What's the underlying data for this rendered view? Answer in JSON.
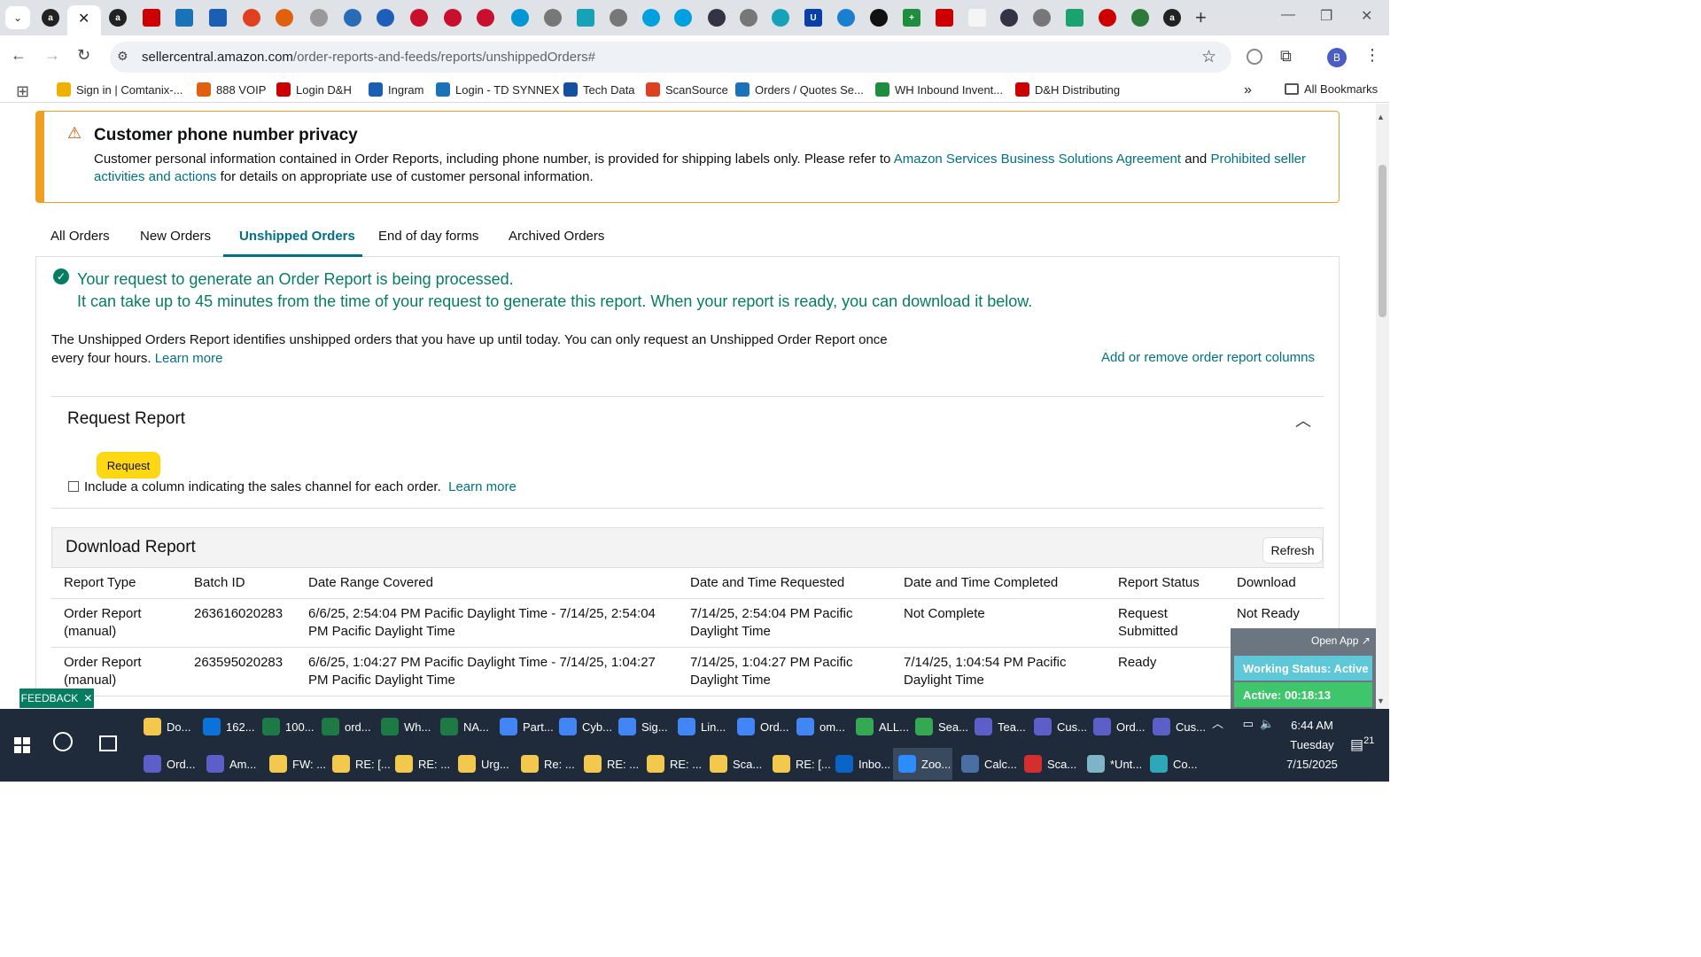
{
  "browser": {
    "url_host": "sellercentral.amazon.com",
    "url_path": "/order-reports-and-feeds/reports/unshippedOrders#",
    "profile_initial": "B",
    "bookmarks": [
      {
        "label": "Sign in | Comtanix-...",
        "color": "#f0b000"
      },
      {
        "label": "888 VOIP",
        "color": "#e06010"
      },
      {
        "label": "Login D&H",
        "color": "#c00"
      },
      {
        "label": "Ingram",
        "color": "#1a5fb4"
      },
      {
        "label": "Login - TD SYNNEX",
        "color": "#1a73b8"
      },
      {
        "label": "Tech Data",
        "color": "#1550a0"
      },
      {
        "label": "ScanSource",
        "color": "#e04020"
      },
      {
        "label": "Orders / Quotes Se...",
        "color": "#1a73b8"
      },
      {
        "label": "WH Inbound Invent...",
        "color": "#1e8e3e"
      },
      {
        "label": "D&H Distributing",
        "color": "#c00"
      }
    ],
    "all_bookmarks_label": "All Bookmarks"
  },
  "alert": {
    "title": "Customer phone number privacy",
    "body_1": "Customer personal information contained in Order Reports, including phone number, is provided for shipping labels only. Please refer to ",
    "link_1": "Amazon Services Business Solutions Agreement",
    "body_2": " and ",
    "link_2": "Prohibited seller activities and actions",
    "body_3": " for details on appropriate use of customer personal information."
  },
  "tabs": [
    "All Orders",
    "New Orders",
    "Unshipped Orders",
    "End of day forms",
    "Archived Orders"
  ],
  "success": {
    "line1": "Your request to generate an Order Report is being processed.",
    "line2": "It can take up to 45 minutes from the time of your request to generate this report. When your report is ready, you can download it below."
  },
  "description": {
    "text": "The Unshipped Orders Report identifies unshipped orders that you have up until today. You can only request an Unshipped Order Report once every four hours. ",
    "learn_more": "Learn more",
    "add_columns": "Add or remove order report columns"
  },
  "request": {
    "title": "Request Report",
    "button": "Request",
    "checkbox_label": "Include a column indicating the sales channel for each order.",
    "learn_more": "Learn more"
  },
  "download": {
    "title": "Download Report",
    "refresh": "Refresh",
    "columns": [
      "Report Type",
      "Batch ID",
      "Date Range Covered",
      "Date and Time Requested",
      "Date and Time Completed",
      "Report Status",
      "Download"
    ],
    "rows": [
      [
        "Order Report (manual)",
        "263616020283",
        "6/6/25, 2:54:04 PM Pacific Daylight Time - 7/14/25, 2:54:04 PM Pacific Daylight Time",
        "7/14/25, 2:54:04 PM Pacific Daylight Time",
        "Not Complete",
        "Request Submitted",
        "Not Ready"
      ],
      [
        "Order Report (manual)",
        "263595020283",
        "6/6/25, 1:04:27 PM Pacific Daylight Time - 7/14/25, 1:04:27 PM Pacific Daylight Time",
        "7/14/25, 1:04:27 PM Pacific Daylight Time",
        "7/14/25, 1:04:54 PM Pacific Daylight Time",
        "Ready",
        ""
      ]
    ]
  },
  "feedback": "FEEDBACK",
  "widget": {
    "open_app": "Open App ↗",
    "status": "Working Status: Active",
    "active": "Active: 00:18:13"
  },
  "taskbar": {
    "row1": [
      {
        "label": "Do...",
        "color": "#f2c94c"
      },
      {
        "label": "162...",
        "color": "#0b72d9"
      },
      {
        "label": "100...",
        "color": "#1d7a45"
      },
      {
        "label": "ord...",
        "color": "#1d7a45"
      },
      {
        "label": "Wh...",
        "color": "#1d7a45"
      },
      {
        "label": "NA...",
        "color": "#1d7a45"
      },
      {
        "label": "Part...",
        "color": "#4285f4"
      },
      {
        "label": "Cyb...",
        "color": "#4285f4"
      },
      {
        "label": "Sig...",
        "color": "#4285f4"
      },
      {
        "label": "Lin...",
        "color": "#4285f4"
      },
      {
        "label": "Ord...",
        "color": "#4285f4"
      },
      {
        "label": "om...",
        "color": "#4285f4"
      },
      {
        "label": "ALL...",
        "color": "#34a853"
      },
      {
        "label": "Sea...",
        "color": "#34a853"
      },
      {
        "label": "Tea...",
        "color": "#5b5fc7"
      },
      {
        "label": "Cus...",
        "color": "#5b5fc7"
      },
      {
        "label": "Ord...",
        "color": "#5b5fc7"
      },
      {
        "label": "Cus...",
        "color": "#5b5fc7"
      }
    ],
    "row2": [
      {
        "label": "Ord...",
        "color": "#5b5fc7"
      },
      {
        "label": "Am...",
        "color": "#5b5fc7"
      },
      {
        "label": "FW: ...",
        "color": "#f2c94c"
      },
      {
        "label": "RE: [...",
        "color": "#f2c94c"
      },
      {
        "label": "RE: ...",
        "color": "#f2c94c"
      },
      {
        "label": "Urg...",
        "color": "#f2c94c"
      },
      {
        "label": "Re: ...",
        "color": "#f2c94c"
      },
      {
        "label": "RE: ...",
        "color": "#f2c94c"
      },
      {
        "label": "RE: ...",
        "color": "#f2c94c"
      },
      {
        "label": "Sca...",
        "color": "#f2c94c"
      },
      {
        "label": "RE: [...",
        "color": "#f2c94c"
      },
      {
        "label": "Inbo...",
        "color": "#0a64c8"
      },
      {
        "label": "Zoo...",
        "color": "#2d8cff"
      },
      {
        "label": "Calc...",
        "color": "#4a6fa5"
      },
      {
        "label": "Sca...",
        "color": "#d32f2f"
      },
      {
        "label": "*Unt...",
        "color": "#7fb3c8"
      },
      {
        "label": "Co...",
        "color": "#2ea7b8"
      }
    ],
    "time": "6:44 AM",
    "day": "Tuesday",
    "date": "7/15/2025",
    "notifications": "21"
  }
}
